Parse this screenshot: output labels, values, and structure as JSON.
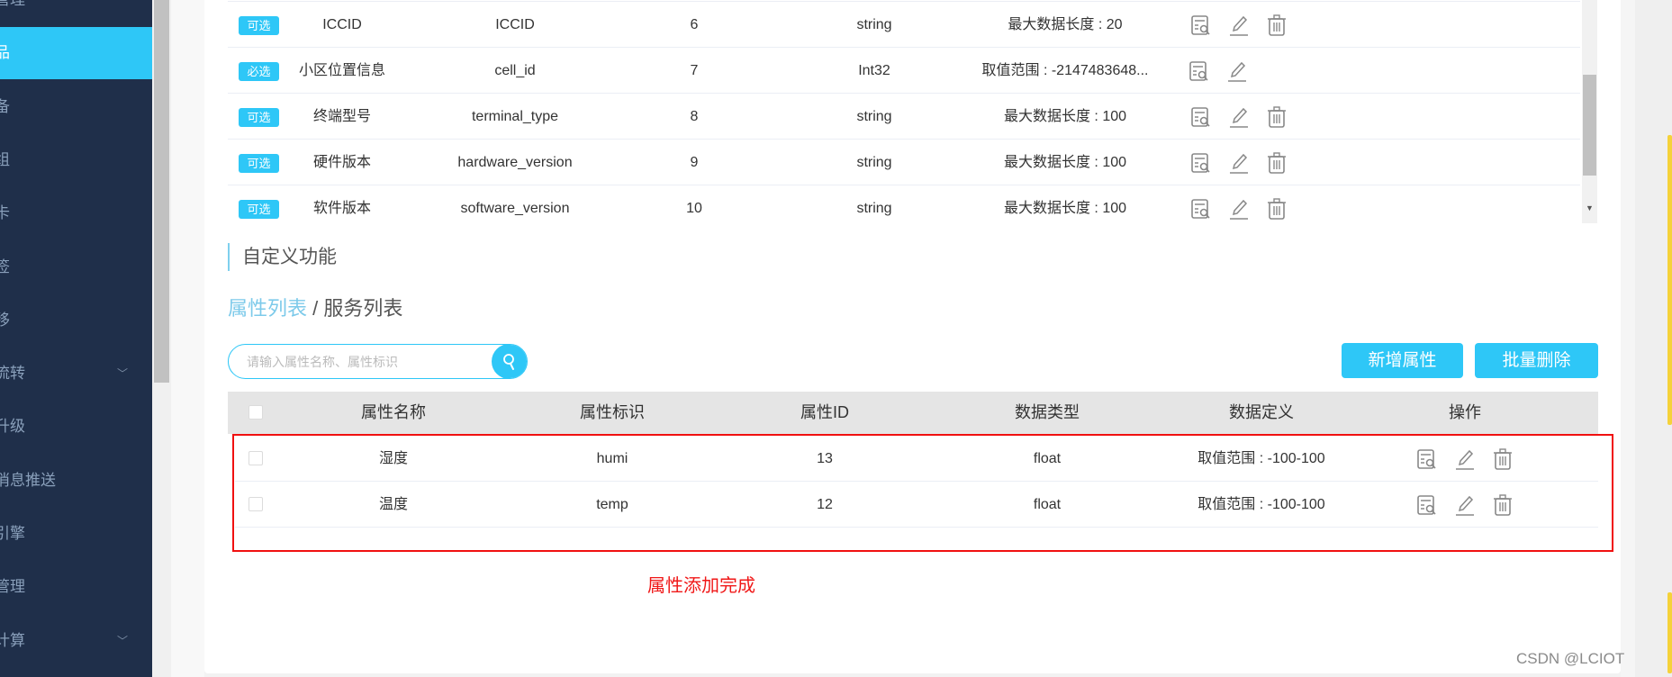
{
  "sidebar": {
    "items": [
      {
        "label": "管理",
        "active": false
      },
      {
        "label": "品",
        "active": true
      },
      {
        "label": "备",
        "active": false
      },
      {
        "label": "组",
        "active": false
      },
      {
        "label": "卡",
        "active": false
      },
      {
        "label": "签",
        "active": false
      },
      {
        "label": "移",
        "active": false
      },
      {
        "label": "流转",
        "active": false,
        "chevron": true
      },
      {
        "label": "升级",
        "active": false
      },
      {
        "label": "消息推送",
        "active": false
      },
      {
        "label": "引擎",
        "active": false
      },
      {
        "label": "管理",
        "active": false
      },
      {
        "label": "计算",
        "active": false,
        "chevron": true
      }
    ]
  },
  "system_table": {
    "rows": [
      {
        "badge": "可选",
        "name": "ICCID",
        "identifier": "ICCID",
        "id": "6",
        "type": "string",
        "definition": "最大数据长度 : 20",
        "deletable": true
      },
      {
        "badge": "必选",
        "name": "小区位置信息",
        "identifier": "cell_id",
        "id": "7",
        "type": "Int32",
        "definition": "取值范围 : -2147483648...",
        "deletable": false
      },
      {
        "badge": "可选",
        "name": "终端型号",
        "identifier": "terminal_type",
        "id": "8",
        "type": "string",
        "definition": "最大数据长度 : 100",
        "deletable": true
      },
      {
        "badge": "可选",
        "name": "硬件版本",
        "identifier": "hardware_version",
        "id": "9",
        "type": "string",
        "definition": "最大数据长度 : 100",
        "deletable": true
      },
      {
        "badge": "可选",
        "name": "软件版本",
        "identifier": "software_version",
        "id": "10",
        "type": "string",
        "definition": "最大数据长度 : 100",
        "deletable": true
      }
    ]
  },
  "custom": {
    "section_title": "自定义功能",
    "tab_active": "属性列表",
    "tab_separator": " / ",
    "tab_inactive": "服务列表",
    "search_placeholder": "请输入属性名称、属性标识",
    "add_button": "新增属性",
    "batch_delete_button": "批量删除",
    "columns": [
      "属性名称",
      "属性标识",
      "属性ID",
      "数据类型",
      "数据定义",
      "操作"
    ],
    "rows": [
      {
        "name": "湿度",
        "identifier": "humi",
        "id": "13",
        "type": "float",
        "definition": "取值范围 : -100-100"
      },
      {
        "name": "温度",
        "identifier": "temp",
        "id": "12",
        "type": "float",
        "definition": "取值范围 : -100-100"
      }
    ]
  },
  "annotation": "属性添加完成",
  "watermark": "CSDN @LCIOT",
  "colors": {
    "accent": "#2ec7f7",
    "sidebar": "#1f2f4a",
    "annotation": "#f01010"
  }
}
